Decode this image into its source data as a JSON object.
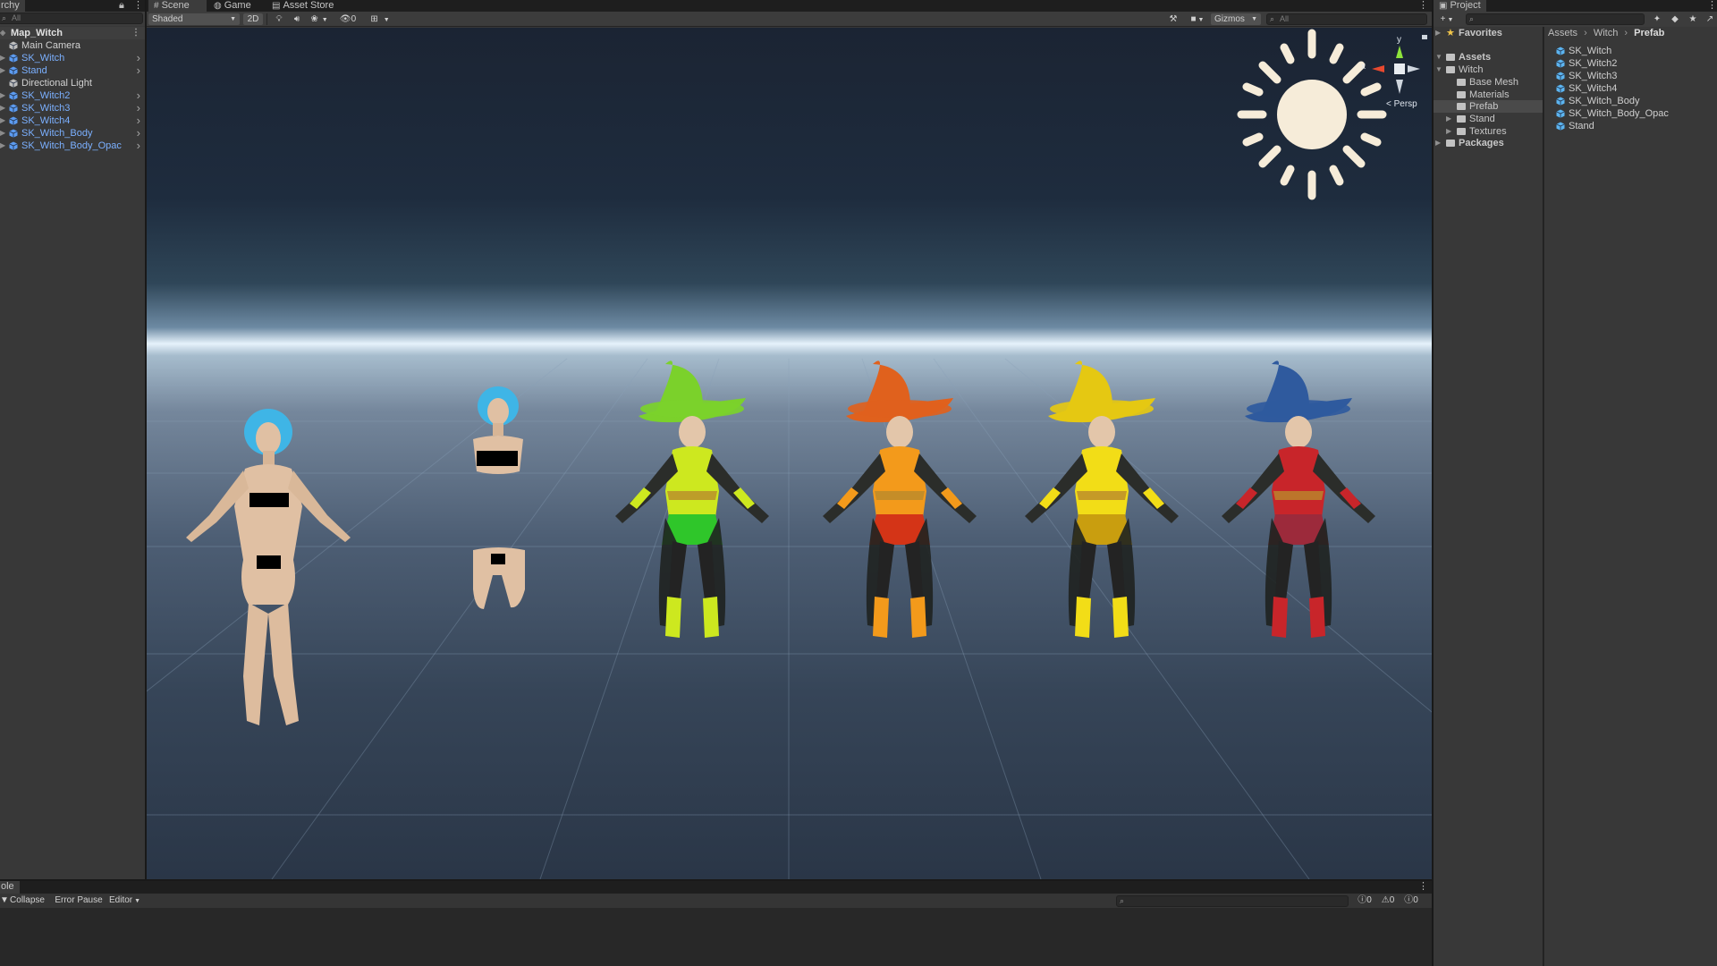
{
  "colors": {
    "accent_prefab": "#7bb0ff",
    "selection": "#3e5f96"
  },
  "hierarchy": {
    "tab_label": "rchy",
    "search_placeholder": "All",
    "scene_name": "Map_Witch",
    "items": [
      {
        "label": "Main Camera",
        "kind": "gameobject",
        "has_children": false
      },
      {
        "label": "SK_Witch",
        "kind": "prefab",
        "has_children": true
      },
      {
        "label": "Stand",
        "kind": "prefab",
        "has_children": true
      },
      {
        "label": "Directional Light",
        "kind": "gameobject",
        "has_children": false
      },
      {
        "label": "SK_Witch2",
        "kind": "prefab",
        "has_children": true
      },
      {
        "label": "SK_Witch3",
        "kind": "prefab",
        "has_children": true
      },
      {
        "label": "SK_Witch4",
        "kind": "prefab",
        "has_children": true
      },
      {
        "label": "SK_Witch_Body",
        "kind": "prefab",
        "has_children": true
      },
      {
        "label": "SK_Witch_Body_Opac",
        "kind": "prefab",
        "has_children": true
      }
    ]
  },
  "scene": {
    "tabs": [
      {
        "label": "Scene",
        "icon": "grid-icon"
      },
      {
        "label": "Game",
        "icon": "gamepad-icon"
      },
      {
        "label": "Asset Store",
        "icon": "bag-icon"
      }
    ],
    "toolbar": {
      "shading_mode": "Shaded",
      "mode_2d": "2D",
      "hidden_count": "0",
      "gizmos_label": "Gizmos",
      "search_placeholder": "All"
    },
    "persp_label": "Persp",
    "gizmo_axis_y": "y",
    "gizmo_axis_x": "x",
    "figures": [
      {
        "name": "nude-body",
        "hair": "#3fb5e6",
        "skin": "#e0c0a3"
      },
      {
        "name": "body-parts",
        "hair": "#3fb5e6",
        "skin": "#e0c0a3"
      },
      {
        "name": "green-witch",
        "primary": "#cde81f",
        "secondary": "#2fc62a",
        "hat": "#7bd12b"
      },
      {
        "name": "orange-witch",
        "primary": "#f39a1b",
        "secondary": "#d43417",
        "hat": "#e0611d"
      },
      {
        "name": "yellow-witch",
        "primary": "#f2dd17",
        "secondary": "#c99e0f",
        "hat": "#e5c812"
      },
      {
        "name": "red-witch",
        "primary": "#c8252a",
        "secondary": "#9c2a3b",
        "hat": "#2f5a9e"
      }
    ]
  },
  "console": {
    "tab_label": "ole",
    "collapse": "Collapse",
    "error_pause": "Error Pause",
    "editor": "Editor",
    "count_log": "0",
    "count_warn": "0",
    "count_error": "0"
  },
  "project": {
    "tab_label": "Project",
    "favorites": "Favorites",
    "assets": "Assets",
    "folders": [
      "Witch",
      "Base Mesh",
      "Materials",
      "Prefab",
      "Stand",
      "Textures"
    ],
    "packages": "Packages",
    "breadcrumb": [
      "Assets",
      "Witch",
      "Prefab"
    ],
    "assets_list": [
      "SK_Witch",
      "SK_Witch2",
      "SK_Witch3",
      "SK_Witch4",
      "SK_Witch_Body",
      "SK_Witch_Body_Opac",
      "Stand"
    ]
  }
}
